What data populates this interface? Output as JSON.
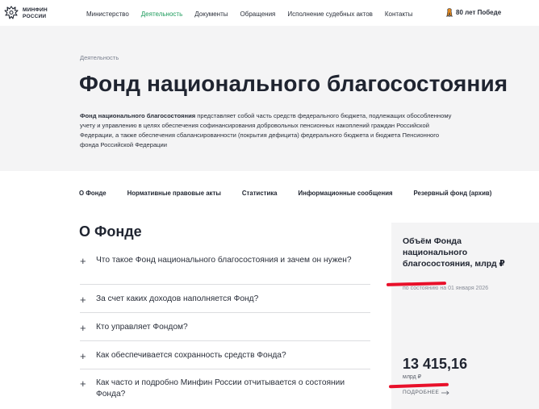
{
  "header": {
    "logo_line1": "МИНФИН",
    "logo_line2": "РОССИИ",
    "nav": [
      {
        "label": "Министерство"
      },
      {
        "label": "Деятельность",
        "active": true
      },
      {
        "label": "Документы"
      },
      {
        "label": "Обращения"
      },
      {
        "label": "Исполнение судебных актов"
      },
      {
        "label": "Контакты"
      }
    ],
    "victory_label": "80 лет Победе"
  },
  "hero": {
    "breadcrumb": "Деятельность",
    "title": "Фонд национального благосостояния",
    "intro_bold": "Фонд национального благосостояния",
    "intro_rest": " представляет собой часть средств федерального бюджета, подлежащих обособленному учету и управлению в целях обеспечения софинансирования добровольных пенсионных накоплений граждан Российской Федерации, а также обеспечения сбалансированности (покрытия дефицита) федерального бюджета и бюджета Пенсионного фонда Российской Федерации"
  },
  "tabs": [
    {
      "label": "О Фонде"
    },
    {
      "label": "Нормативные правовые акты"
    },
    {
      "label": "Статистика"
    },
    {
      "label": "Информационные сообщения"
    },
    {
      "label": "Резервный фонд (архив)"
    }
  ],
  "section": {
    "title": "О Фонде",
    "faq": [
      {
        "question": "Что такое Фонд национального благосостояния и зачем он нужен?"
      },
      {
        "question": "За счет каких доходов наполняется Фонд?"
      },
      {
        "question": "Кто управляет Фондом?"
      },
      {
        "question": "Как обеспечивается сохранность средств Фонда?"
      },
      {
        "question": "Как часто и подробно Минфин России отчитывается о состоянии Фонда?"
      }
    ]
  },
  "panel": {
    "title": "Объём Фонда национального благосостояния, млрд ₽",
    "date": "по состоянию на 01 января 2026",
    "value": "13 415,16",
    "unit": "млрд ₽",
    "more_label": "ПОДРОБНЕЕ"
  },
  "colors": {
    "accent": "#1a9a5a",
    "annotation": "#e8102a",
    "hero_bg": "#f4f4f5"
  }
}
